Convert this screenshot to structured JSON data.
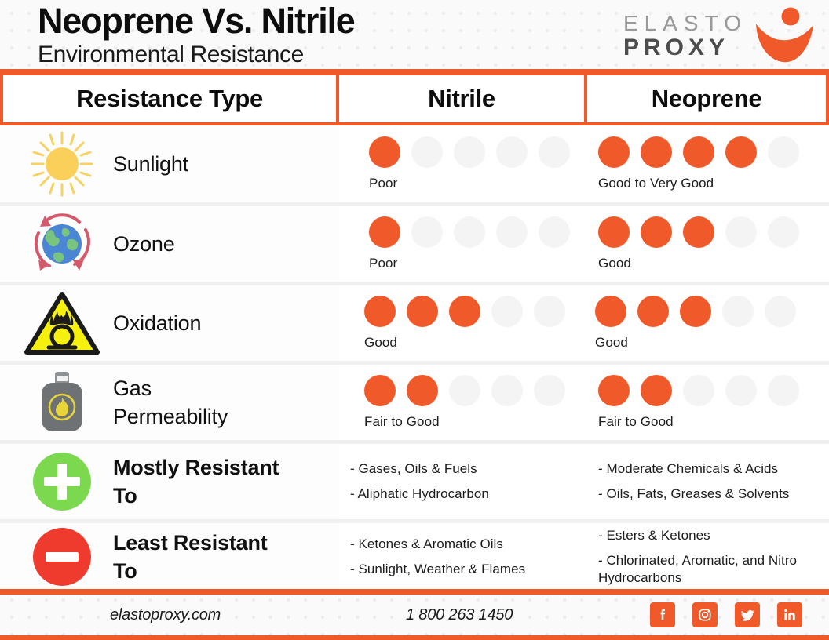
{
  "header": {
    "title": "Neoprene Vs. Nitrile",
    "subtitle": "Environmental Resistance",
    "logo": {
      "line1": "ELASTO",
      "line2": "PROXY",
      "mark_name": "elasto-proxy-swoosh-figure"
    }
  },
  "table": {
    "columns": [
      "Resistance Type",
      "Nitrile",
      "Neoprene"
    ],
    "rating_max": 5,
    "rows": [
      {
        "icon": "sun-icon",
        "label": "Sunlight",
        "type": "rating",
        "nitrile": {
          "filled": 1,
          "text": "Poor"
        },
        "neoprene": {
          "filled": 4,
          "text": "Good to Very Good"
        }
      },
      {
        "icon": "ozone-globe-icon",
        "label": "Ozone",
        "type": "rating",
        "nitrile": {
          "filled": 1,
          "text": "Poor"
        },
        "neoprene": {
          "filled": 3,
          "text": "Good"
        }
      },
      {
        "icon": "oxidizer-hazard-icon",
        "label": "Oxidation",
        "type": "rating",
        "nitrile": {
          "filled": 3,
          "text": "Good"
        },
        "neoprene": {
          "filled": 3,
          "text": "Good"
        }
      },
      {
        "icon": "gas-tank-icon",
        "label": "Gas Permeability",
        "type": "rating",
        "nitrile": {
          "filled": 2,
          "text": "Fair to Good"
        },
        "neoprene": {
          "filled": 2,
          "text": "Fair to Good"
        }
      },
      {
        "icon": "plus-circle-icon",
        "label": "Mostly Resistant To",
        "type": "bullets",
        "nitrile": {
          "bullets": [
            "- Gases, Oils & Fuels",
            "- Aliphatic Hydrocarbon"
          ]
        },
        "neoprene": {
          "bullets": [
            "- Moderate Chemicals & Acids",
            "- Oils, Fats, Greases & Solvents"
          ]
        }
      },
      {
        "icon": "minus-circle-icon",
        "label": "Least Resistant To",
        "type": "bullets",
        "nitrile": {
          "bullets": [
            "- Ketones & Aromatic Oils",
            "- Sunlight, Weather & Flames"
          ]
        },
        "neoprene": {
          "bullets": [
            "- Esters & Ketones",
            "- Chlorinated, Aromatic, and Nitro Hydrocarbons"
          ]
        }
      }
    ]
  },
  "footer": {
    "website": "elastoproxy.com",
    "phone": "1 800 263 1450",
    "socials": [
      "facebook-icon",
      "instagram-icon",
      "twitter-icon",
      "linkedin-icon"
    ]
  },
  "colors": {
    "accent_orange": "#f05a2a",
    "dot_empty": "#f4f4f4",
    "background": "#fafafa",
    "sun_yellow": "#fbd05a",
    "globe_blue": "#4a86d4",
    "globe_green": "#79c47e",
    "ozone_arrow": "#d4596a",
    "hazard_yellow": "#f5f00d",
    "tank_gray": "#6e7275",
    "flame_yellow": "#e8d53a",
    "plus_green": "#7bd84f",
    "minus_red": "#ef3b2d"
  }
}
